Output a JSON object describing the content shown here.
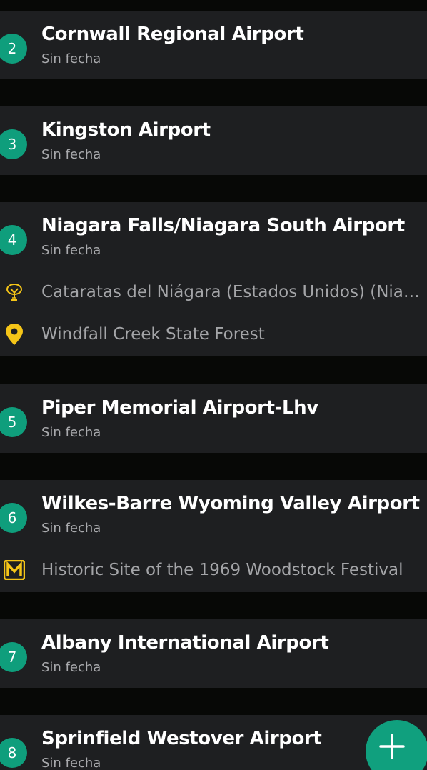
{
  "subtitle_default": "Sin fecha",
  "colors": {
    "accent": "#0f9e7c",
    "card": "#1e1f21",
    "background": "#070806",
    "icon_yellow": "#f5c518"
  },
  "items": [
    {
      "number": "2",
      "title": "Cornwall Regional Airport",
      "subtitle": "Sin fecha"
    },
    {
      "number": "3",
      "title": "Kingston Airport",
      "subtitle": "Sin fecha"
    },
    {
      "number": "4",
      "title": "Niagara Falls/Niagara South Airport",
      "subtitle": "Sin fecha",
      "places": [
        {
          "icon": "waterfall-icon",
          "text": "Cataratas del Niágara (Estados Unidos) (Niag…"
        },
        {
          "icon": "map-pin-icon",
          "text": "Windfall Creek State Forest"
        }
      ]
    },
    {
      "number": "5",
      "title": "Piper Memorial Airport-Lhv",
      "subtitle": "Sin fecha"
    },
    {
      "number": "6",
      "title": "Wilkes-Barre Wyoming Valley Airport",
      "subtitle": "Sin fecha",
      "places": [
        {
          "icon": "museum-icon",
          "text": "Historic Site of the 1969 Woodstock Festival"
        }
      ]
    },
    {
      "number": "7",
      "title": "Albany International Airport",
      "subtitle": "Sin fecha"
    },
    {
      "number": "8",
      "title": "Sprinfield Westover Airport",
      "subtitle": "Sin fecha"
    }
  ],
  "fab": {
    "icon": "plus-icon"
  }
}
